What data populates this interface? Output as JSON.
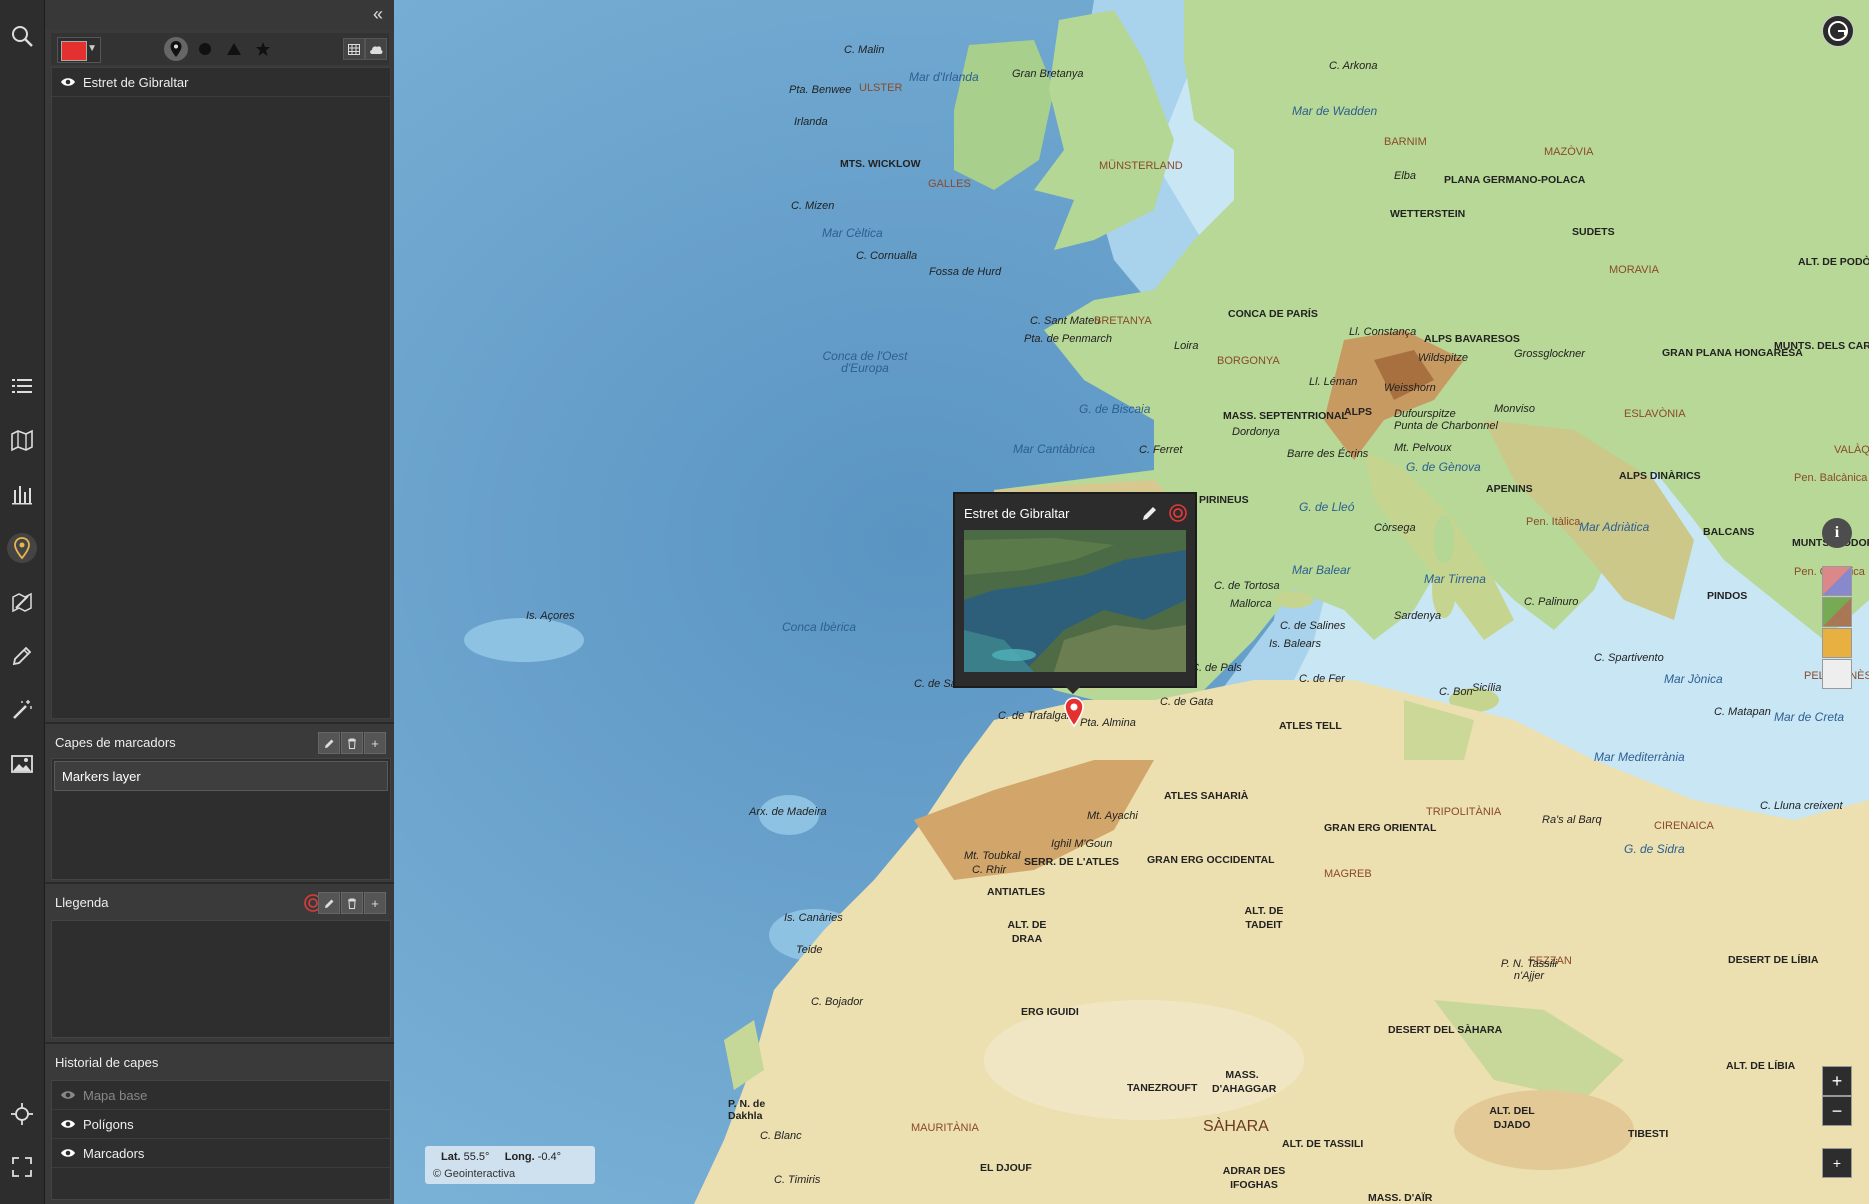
{
  "panel": {
    "collapse_icon": "double-chevron-left",
    "selected_color": "#e53030",
    "marker_items": [
      {
        "label": "Estret de Gibraltar",
        "visible": true
      }
    ],
    "layers_section": {
      "title": "Capes de marcadors",
      "items": [
        "Markers layer"
      ]
    },
    "legend_section": {
      "title": "Llegenda"
    },
    "history_section": {
      "title": "Historial de capes",
      "items": [
        {
          "label": "Mapa base",
          "visible": false
        },
        {
          "label": "Polígons",
          "visible": true
        },
        {
          "label": "Marcadors",
          "visible": true
        }
      ]
    }
  },
  "rail_icons": [
    "search-icon",
    "list-icon",
    "map-icon",
    "bar-chart-icon",
    "marker-icon",
    "compass-edit-icon",
    "pencil-icon",
    "magic-wand-icon",
    "image-icon",
    "crosshair-icon",
    "fullscreen-icon"
  ],
  "popup": {
    "title": "Estret de Gibraltar"
  },
  "coords": {
    "lat_label": "Lat.",
    "lat_value": "55.5°",
    "lon_label": "Long.",
    "lon_value": "-0.4°",
    "credit": "© Geointeractiva"
  },
  "controls": {
    "zoom_in": "+",
    "zoom_out": "−"
  },
  "map_labels": {
    "mar_irlanda": "Mar d'Irlanda",
    "mar_wadden": "Mar de Wadden",
    "mar_celtica": "Mar Cèltica",
    "mar_cantabrica": "Mar Cantàbrica",
    "conca_oest": "Conca de l'Oest d'Europa",
    "conca_iberica": "Conca Ibèrica",
    "is_acores": "Is. Açores",
    "arx_madeira": "Arx. de Madeira",
    "is_canaries": "Is. Canàries",
    "teide": "Teide",
    "mar_balear": "Mar Balear",
    "mar_tirrena": "Mar Tirrena",
    "mar_adriatica": "Mar Adriàtica",
    "mar_jonica": "Mar Jònica",
    "mar_mediterrania": "Mar Mediterrània",
    "mar_creta": "Mar de Creta",
    "g_biscaia": "G. de Biscaia",
    "g_lleo": "G. de Lleó",
    "g_genova": "G. de Gènova",
    "g_sidra": "G. de Sidra",
    "ulster": "ULSTER",
    "mts_wicklow": "MTS. WICKLOW",
    "galles": "GALLES",
    "bretanya": "BRETANYA",
    "munsterland": "MÜNSTERLAND",
    "barnim": "BARNIM",
    "mazovia": "MAZÒVIA",
    "wetterstein": "WETTERSTEIN",
    "sudets": "SUDETS",
    "morava": "MORAVIA",
    "plana_germano": "PLANA GERMANO-POLACA",
    "alt_podolia": "ALT. DE PODÒLIA",
    "conca_paris": "CONCA DE PARÍS",
    "alps_bavaresos": "ALPS BAVARESOS",
    "borgonya": "BORGONYA",
    "gran_plana": "GRAN PLANA HONGARESA",
    "munts_carpats": "MUNTS. DELS CARPATS",
    "mass_septentrional": "MASS. SEPTENTRIONAL",
    "alps": "ALPS",
    "eslavonia": "ESLAVÒNIA",
    "valaquia": "VALÀQUIA",
    "alps_dinarics": "ALPS DINÀRICS",
    "apenins": "APENINS",
    "balcans": "BALCANS",
    "pirineus": "PIRINEUS",
    "pindos": "PINDOS",
    "peloponès": "PELOPONÈS",
    "atles_tell": "ATLES TELL",
    "atles_saharia": "ATLES SAHARIÀ",
    "gran_erg_oriental": "GRAN ERG ORIENTAL",
    "gran_erg_occidental": "GRAN ERG OCCIDENTAL",
    "tripolitania": "TRIPOLITÀNIA",
    "cirenaica": "CIRENAICA",
    "magreb": "MAGREB",
    "serr_atles": "SERR. DE L'ATLES",
    "antiatles": "ANTIATLES",
    "alt_draa": "ALT. DE DRAA",
    "alt_tadeit": "ALT. DE TADEIT",
    "fezzan": "FEZZAN",
    "desert_libia": "DESERT DE LÍBIA",
    "erg_iguidi": "ERG IGUIDI",
    "desert_sahara": "DESERT DEL SÀHARA",
    "tassili": "P. N. Tassili n'Ajjer",
    "mass_ahaggar": "MASS. D'AHAGGAR",
    "tanezrouft": "TANEZROUFT",
    "sahara": "SÀHARA",
    "alt_tassili": "ALT. DE TASSILI",
    "alt_djado": "ALT. DEL DJADO",
    "alt_libia": "ALT. DE LÍBIA",
    "tibesti": "TIBESTI",
    "mauritania": "MAURITÀNIA",
    "el_djouf": "EL DJOUF",
    "adrar": "ADRAR DES IFOGHAS",
    "mass_air": "MASS. D'AÏR",
    "pta_almina": "Pta. Almina",
    "c_trafalgar": "C. de Trafalgar",
    "c_sant_vicente": "C. de Sant Vicente",
    "c_gata": "C. de Gata",
    "c_pals": "C. de Pals",
    "c_tortosa": "C. de Tortosa",
    "c_salines": "C. de Salines",
    "mallorca": "Mallorca",
    "is_balears": "Is. Balears",
    "corsega": "Còrsega",
    "sardenya": "Sardenya",
    "sicilia": "Sicília",
    "c_bon": "C. Bon",
    "c_fer": "C. de Fer",
    "c_bojador": "C. Bojador",
    "c_blanc": "C. Blanc",
    "c_timiris": "C. Timiris",
    "mt_toubkal": "Mt. Toubkal",
    "mt_ayachi": "Mt. Ayachi",
    "ighil": "Ighil M'Goun",
    "c_rhir": "C. Rhir",
    "dakhla": "P. N. de Dakhla",
    "ras_barq": "Ra's al Barq",
    "c_lluna": "C. Lluna creixent",
    "c_malin": "C. Malin",
    "pta_benwee": "Pta. Benwee",
    "irlanda": "Irlanda",
    "c_mizen": "C. Mizen",
    "c_cornualla": "C. Cornualla",
    "fossa_hurd": "Fossa de Hurd",
    "c_sant_mateu": "C. Sant Mateu",
    "pta_penmarch": "Pta. de Penmarch",
    "gran_bretanya": "Gran Bretanya",
    "c_ferret": "C. Ferret",
    "dordonya": "Dordonya",
    "loira": "Loira",
    "elba": "Elba",
    "c_arkona": "C. Arkona",
    "mt_pelvoux": "Mt. Pelvoux",
    "barre_ecrins": "Barre des Écrins",
    "pen_italica": "Pen. Itàlica",
    "pen_balcanica": "Pen. Balcànica",
    "pen_calcidica": "Pen. Calcídica",
    "munts_rodope": "MUNTS. RÒDOPE",
    "c_palinuro": "C. Palinuro",
    "c_spartivento": "C. Spartivento",
    "c_matapan": "C. Matapan",
    "wildspitze": "Wildspitze",
    "grossglockner": "Grossglockner",
    "weisshorn": "Weisshorn",
    "dufourspitze": "Dufourspitze",
    "punta_charbonnel": "Punta de Charbonnel",
    "monviso": "Monviso",
    "llac_constanca": "Ll. Constança",
    "llac_leman": "Ll. Léman"
  }
}
